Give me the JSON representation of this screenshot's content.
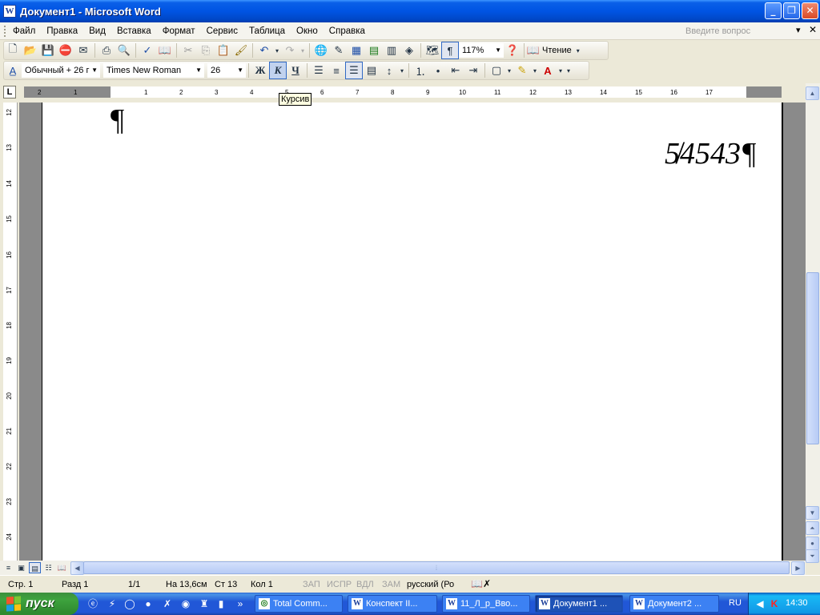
{
  "window": {
    "title": "Документ1 - Microsoft Word"
  },
  "menu": {
    "items": [
      "Файл",
      "Правка",
      "Вид",
      "Вставка",
      "Формат",
      "Сервис",
      "Таблица",
      "Окно",
      "Справка"
    ],
    "question_placeholder": "Введите вопрос"
  },
  "toolbar_standard": {
    "zoom": "117%",
    "reading_label": "Чтение"
  },
  "toolbar_format": {
    "style": "Обычный + 26 г",
    "font": "Times New Roman",
    "size": "26",
    "bold": "Ж",
    "italic": "К",
    "underline": "Ч"
  },
  "tooltip": "Курсив",
  "ruler": {
    "labels": [
      "2",
      "1",
      "1",
      "2",
      "3",
      "4",
      "5",
      "6",
      "7",
      "8",
      "9",
      "10",
      "11",
      "12",
      "13",
      "14",
      "15",
      "16",
      "17"
    ],
    "vlabels": [
      "12",
      "13",
      "14",
      "15",
      "16",
      "17",
      "18",
      "19",
      "20",
      "21",
      "22",
      "23",
      "24"
    ]
  },
  "document": {
    "pilcrow": "¶",
    "text": "5̸4543¶"
  },
  "status": {
    "page": "Стр. 1",
    "section": "Разд 1",
    "pages": "1/1",
    "at": "На 13,6см",
    "line": "Ст 13",
    "col": "Кол 1",
    "rec": "ЗАП",
    "trk": "ИСПР",
    "ext": "ВДЛ",
    "ovr": "ЗАМ",
    "lang": "русский (Ро"
  },
  "taskbar": {
    "start": "пуск",
    "tasks": [
      "Total Comm...",
      "Конспект II...",
      "11_Л_р_Вво...",
      "Документ1 ...",
      "Документ2 ..."
    ],
    "lang": "RU",
    "time": "14:30"
  },
  "colors": {
    "titlebar": "#0054e3",
    "taskbar": "#2157d7",
    "start": "#3ea33e"
  }
}
